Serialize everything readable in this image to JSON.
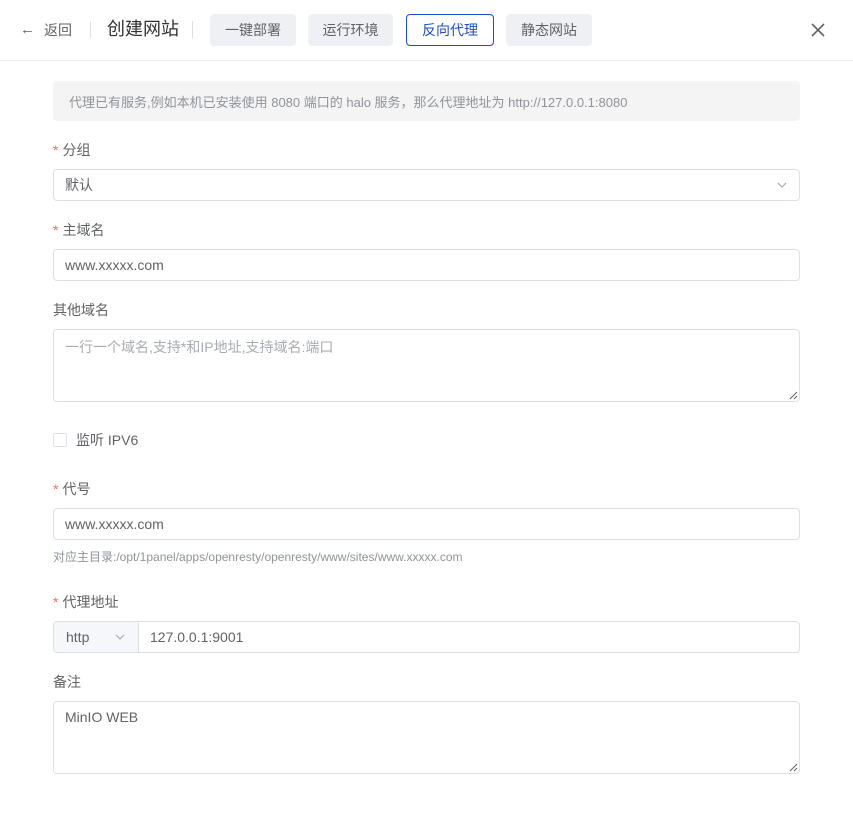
{
  "header": {
    "back_label": "返回",
    "title": "创建网站",
    "tabs": [
      {
        "label": "一键部署",
        "active": false
      },
      {
        "label": "运行环境",
        "active": false
      },
      {
        "label": "反向代理",
        "active": true
      },
      {
        "label": "静态网站",
        "active": false
      }
    ],
    "accent_color": "#1f4dc9"
  },
  "alert": {
    "text": "代理已有服务,例如本机已安装使用 8080 端口的 halo 服务，那么代理地址为 http://127.0.0.1:8080"
  },
  "form": {
    "required_mark": "*",
    "group": {
      "label": "分组",
      "value": "默认",
      "required": true
    },
    "primary_domain": {
      "label": "主域名",
      "value": "www.xxxxx.com",
      "required": true
    },
    "other_domains": {
      "label": "其他域名",
      "placeholder": "一行一个域名,支持*和IP地址,支持域名:端口",
      "value": ""
    },
    "ipv6": {
      "label": "监听 IPV6",
      "checked": false
    },
    "alias": {
      "label": "代号",
      "value": "www.xxxxx.com",
      "required": true,
      "hint": "对应主目录:/opt/1panel/apps/openresty/openresty/www/sites/www.xxxxx.com"
    },
    "proxy": {
      "label": "代理地址",
      "protocol": "http",
      "address": "127.0.0.1:9001",
      "required": true
    },
    "remark": {
      "label": "备注",
      "value": "MinIO WEB"
    }
  }
}
